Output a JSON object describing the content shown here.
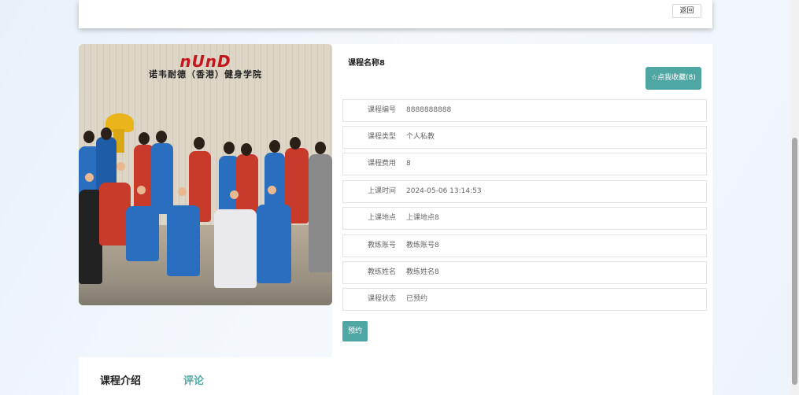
{
  "header": {
    "back_label": "返回"
  },
  "photo": {
    "logo": "nUnD",
    "logo_sub": "诺韦耐德（香港）健身学院"
  },
  "course": {
    "title": "课程名称8",
    "favorite_label": "☆点我收藏(8)",
    "fields": [
      {
        "label": "课程编号",
        "value": "8888888888"
      },
      {
        "label": "课程类型",
        "value": "个人私教"
      },
      {
        "label": "课程费用",
        "value": "8"
      },
      {
        "label": "上课时间",
        "value": "2024-05-06 13:14:53"
      },
      {
        "label": "上课地点",
        "value": "上课地点8"
      },
      {
        "label": "教练账号",
        "value": "教练账号8"
      },
      {
        "label": "教练姓名",
        "value": "教练姓名8"
      },
      {
        "label": "课程状态",
        "value": "已预约"
      }
    ],
    "book_label": "预约"
  },
  "tabs": {
    "intro": "课程介绍",
    "comment": "评论"
  },
  "colors": {
    "accent": "#4fa7a3",
    "logo_red": "#c2161b"
  }
}
